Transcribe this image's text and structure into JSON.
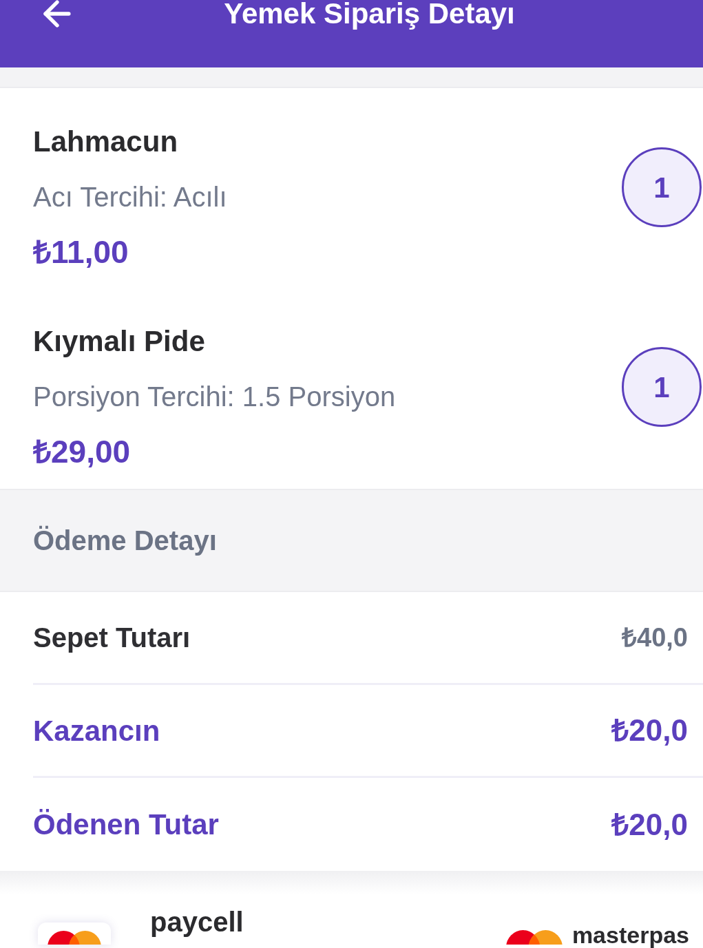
{
  "header": {
    "title": "Yemek Sipariş Detayı"
  },
  "items": [
    {
      "name": "Lahmacun",
      "option": "Acı Tercihi: Acılı",
      "price": "₺11,00",
      "quantity": "1"
    },
    {
      "name": "Kıymalı Pide",
      "option": "Porsiyon Tercihi: 1.5 Porsiyon",
      "price": "₺29,00",
      "quantity": "1"
    }
  ],
  "payment_detail": {
    "heading": "Ödeme Detayı",
    "rows": [
      {
        "kind": "plain",
        "label": "Sepet Tutarı",
        "amount": "₺40,0"
      },
      {
        "kind": "highlight",
        "label": "Kazancın",
        "amount": "₺20,0"
      },
      {
        "kind": "highlight",
        "label": "Ödenen Tutar",
        "amount": "₺20,0"
      }
    ]
  },
  "payment_method": {
    "name": "paycell",
    "provider": "masterpas"
  }
}
